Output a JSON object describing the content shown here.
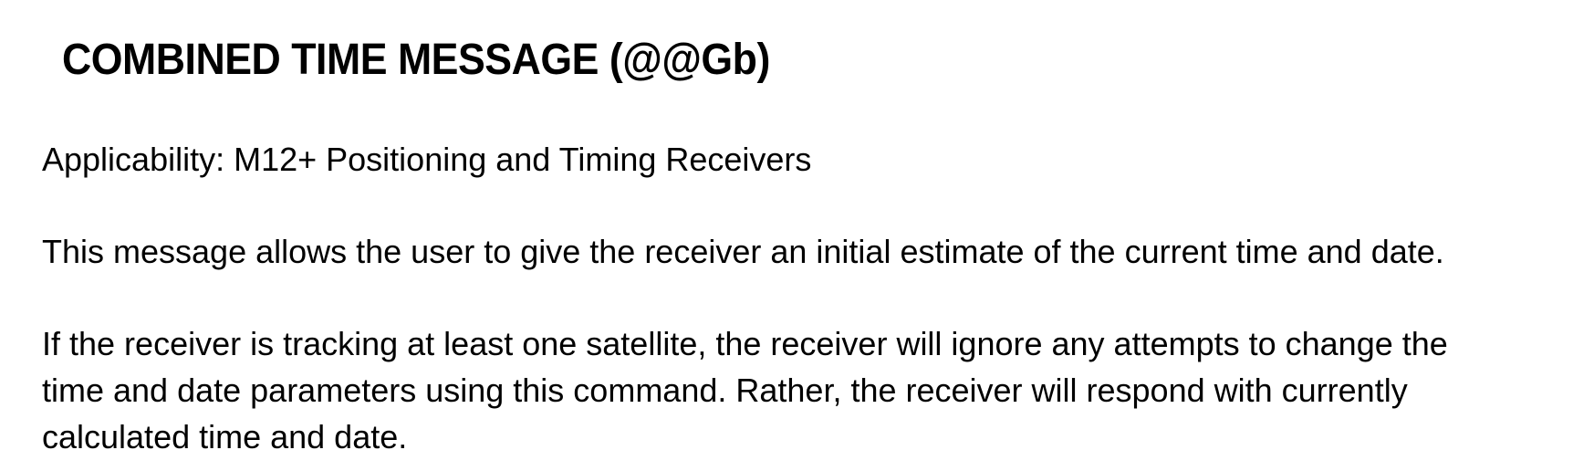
{
  "document": {
    "title": "COMBINED TIME MESSAGE (@@Gb)",
    "applicability": "Applicability: M12+ Positioning and Timing Receivers",
    "intro": "This message allows the user to give the receiver an initial estimate of the current time and date.",
    "tracking_lines": [
      "If the receiver is tracking at least one satellite, the receiver will ignore any attempts to change the",
      "time and date parameters using this command. Rather, the receiver will respond with currently",
      "calculated time and date."
    ]
  }
}
